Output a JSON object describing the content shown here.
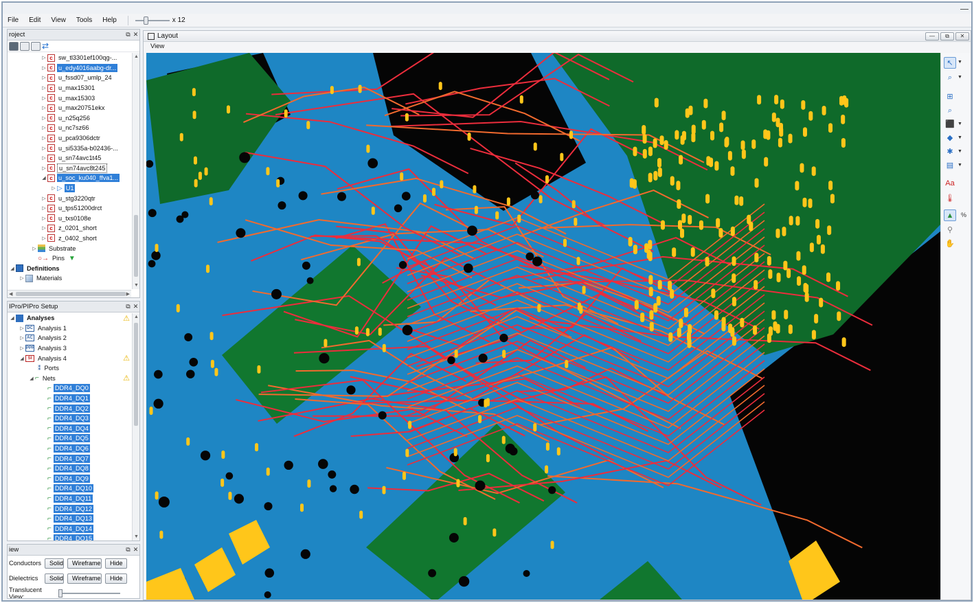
{
  "menu": {
    "items": [
      "File",
      "Edit",
      "View",
      "Tools",
      "Help"
    ],
    "zoom_label": "x 12"
  },
  "project_panel": {
    "title": "roject",
    "items": [
      {
        "label": "sw_tl3301ef100qg-..."
      },
      {
        "label": "u_edy4016aabg-dr..."
      },
      {
        "label": "u_fssd07_umlp_24"
      },
      {
        "label": "u_max15301"
      },
      {
        "label": "u_max15303"
      },
      {
        "label": "u_max20751ekx"
      },
      {
        "label": "u_n25q256"
      },
      {
        "label": "u_nc7sz66"
      },
      {
        "label": "u_pca9306dctr"
      },
      {
        "label": "u_si5335a-b02436-..."
      },
      {
        "label": "u_sn74avc1t45"
      },
      {
        "label": "u_sn74avc8t245"
      },
      {
        "label": "u_soc_ku040_ffva1..."
      },
      {
        "label": "U1"
      },
      {
        "label": "u_stg3220qtr"
      },
      {
        "label": "u_tps51200drct"
      },
      {
        "label": "u_txs0108e"
      },
      {
        "label": "z_0201_short"
      },
      {
        "label": "z_0402_short"
      },
      {
        "label": "Substrate"
      },
      {
        "label": "Pins"
      },
      {
        "label": "Definitions"
      },
      {
        "label": "Materials"
      }
    ]
  },
  "setup_panel": {
    "title": "IPro/PIPro Setup",
    "analyses_label": "Analyses",
    "analyses": [
      {
        "label": "Analysis 1",
        "icon": "DC"
      },
      {
        "label": "Analysis 2",
        "icon": "AC"
      },
      {
        "label": "Analysis 3",
        "icon": "PPR"
      },
      {
        "label": "Analysis 4",
        "icon": "SI"
      }
    ],
    "ports_label": "Ports",
    "nets_label": "Nets",
    "nets": [
      "DDR4_DQ0",
      "DDR4_DQ1",
      "DDR4_DQ2",
      "DDR4_DQ3",
      "DDR4_DQ4",
      "DDR4_DQ5",
      "DDR4_DQ6",
      "DDR4_DQ7",
      "DDR4_DQ8",
      "DDR4_DQ9",
      "DDR4_DQ10",
      "DDR4_DQ11",
      "DDR4_DQ12",
      "DDR4_DQ13",
      "DDR4_DQ14",
      "DDR4_DQ15"
    ]
  },
  "view_panel": {
    "title": "iew",
    "conductors_label": "Conductors",
    "dielectrics_label": "Dielectrics",
    "solid_label": "Solid",
    "wireframe_label": "Wireframe",
    "hide_label": "Hide",
    "translucent_label": "Translucent View:"
  },
  "layout_window": {
    "title": "Layout",
    "menu_view": "View"
  },
  "colors": {
    "board_blue": "#1e86c4",
    "ground_green": "#0f6a2a",
    "trace_red": "#ec2d3c",
    "trace_orange": "#f26a2e",
    "pad_yellow": "#ffc61a",
    "void_black": "#050505",
    "selection_blue": "#2f7fd8"
  },
  "icons": [
    "settings-icon",
    "refresh-icon",
    "component-icon",
    "substrate-icon",
    "pins-icon",
    "filter-icon",
    "definitions-icon",
    "materials-icon",
    "warning-icon",
    "net-icon",
    "select-arrow-icon",
    "zoom-icon",
    "cube-icon",
    "layers-icon",
    "text-icon",
    "thermometer-icon",
    "percent-icon"
  ]
}
